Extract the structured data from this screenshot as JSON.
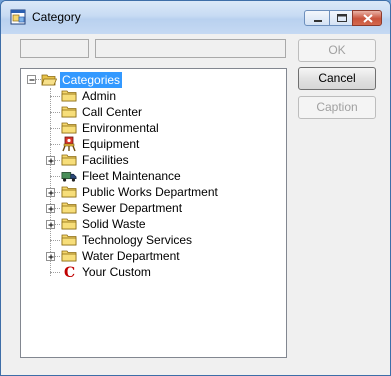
{
  "window": {
    "title": "Category"
  },
  "buttons": {
    "ok": "OK",
    "cancel": "Cancel",
    "caption": "Caption"
  },
  "fields": {
    "code": "",
    "description": ""
  },
  "tree": {
    "root": {
      "label": "Categories",
      "expanded": true,
      "icon": "folder-open-icon"
    },
    "items": [
      {
        "label": "Admin",
        "icon": "folder-icon",
        "expandable": false
      },
      {
        "label": "Call Center",
        "icon": "folder-icon",
        "expandable": false
      },
      {
        "label": "Environmental",
        "icon": "folder-icon",
        "expandable": false
      },
      {
        "label": "Equipment",
        "icon": "equipment-icon",
        "expandable": false
      },
      {
        "label": "Facilities",
        "icon": "folder-icon",
        "expandable": true
      },
      {
        "label": "Fleet Maintenance",
        "icon": "truck-icon",
        "expandable": false
      },
      {
        "label": "Public Works Department",
        "icon": "folder-icon",
        "expandable": true
      },
      {
        "label": "Sewer Department",
        "icon": "folder-icon",
        "expandable": true
      },
      {
        "label": "Solid Waste",
        "icon": "folder-icon",
        "expandable": true
      },
      {
        "label": "Technology Services",
        "icon": "folder-icon",
        "expandable": false
      },
      {
        "label": "Water Department",
        "icon": "folder-icon",
        "expandable": true
      },
      {
        "label": "Your Custom",
        "icon": "custom-c-icon",
        "expandable": false
      }
    ]
  },
  "colors": {
    "selection": "#3399ff",
    "folder": "#f5d76e",
    "custom_c": "#c00000"
  }
}
